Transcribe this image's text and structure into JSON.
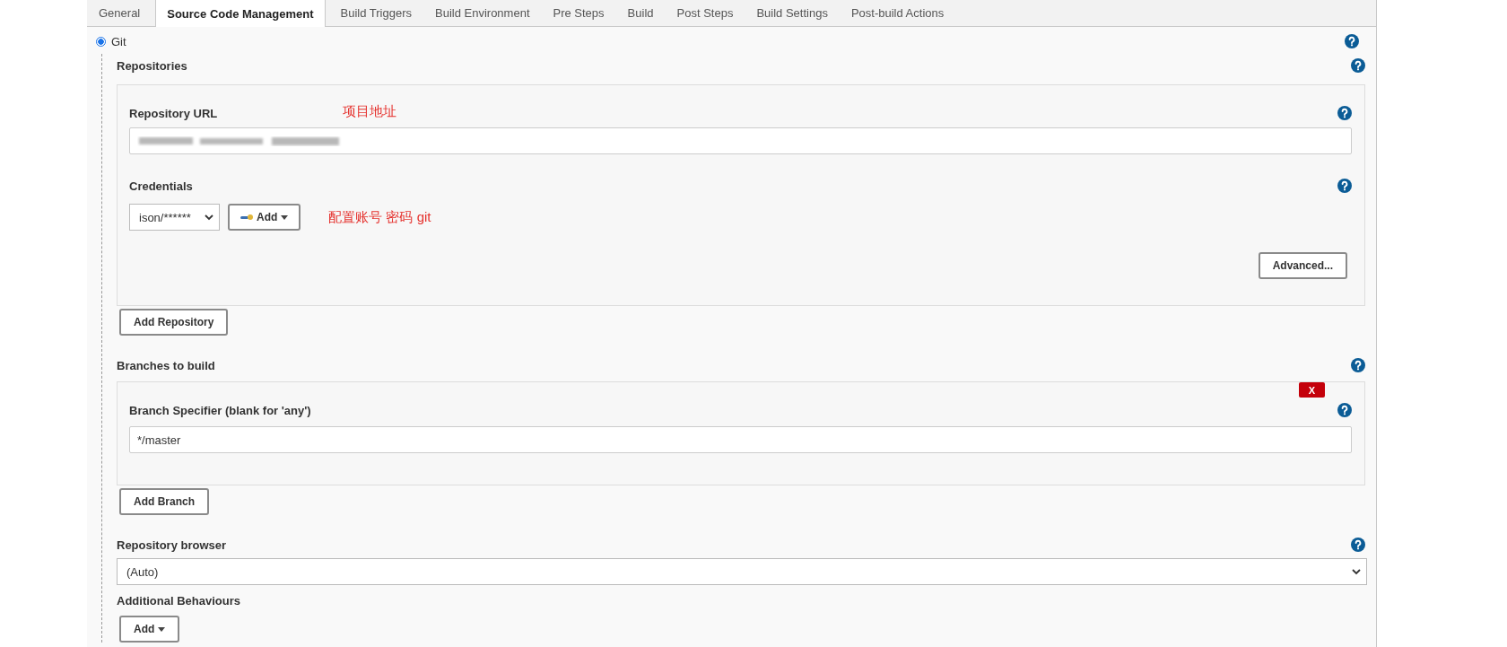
{
  "tabs": [
    {
      "label": "General",
      "selected": false
    },
    {
      "label": "Source Code Management",
      "selected": true
    },
    {
      "label": "Build Triggers",
      "selected": false
    },
    {
      "label": "Build Environment",
      "selected": false
    },
    {
      "label": "Pre Steps",
      "selected": false
    },
    {
      "label": "Build",
      "selected": false
    },
    {
      "label": "Post Steps",
      "selected": false
    },
    {
      "label": "Build Settings",
      "selected": false
    },
    {
      "label": "Post-build Actions",
      "selected": false
    }
  ],
  "scm": {
    "option": {
      "label": "Git",
      "selected": true
    },
    "repositories": {
      "label": "Repositories",
      "items": [
        {
          "url_label": "Repository URL",
          "url_annotation": "项目地址",
          "credentials_label": "Credentials",
          "credentials_value": "ison/******",
          "credentials_add_button": "Add",
          "credentials_annotation": "配置账号 密码 git",
          "advanced_button": "Advanced..."
        }
      ],
      "add_button": "Add Repository"
    },
    "branches": {
      "label": "Branches to build",
      "items": [
        {
          "label": "Branch Specifier (blank for 'any')",
          "value": "*/master",
          "delete_button": "X"
        }
      ],
      "add_button": "Add Branch"
    },
    "repository_browser": {
      "label": "Repository browser",
      "value": "(Auto)"
    },
    "additional_behaviours": {
      "label": "Additional Behaviours",
      "add_button": "Add"
    }
  }
}
